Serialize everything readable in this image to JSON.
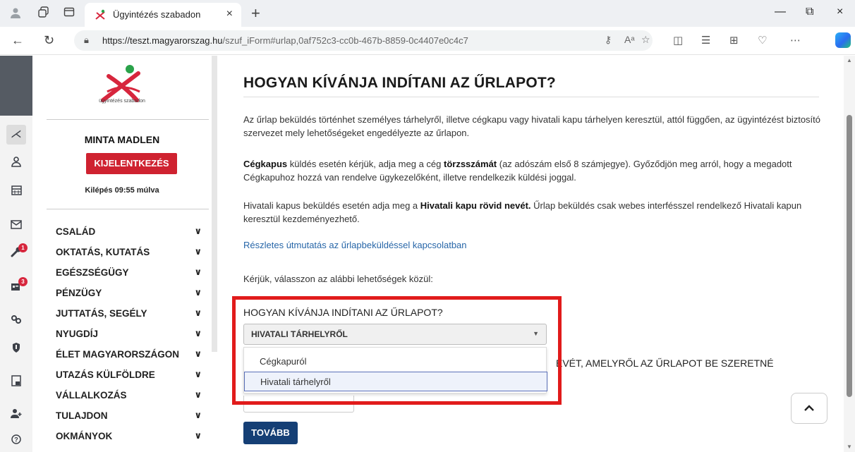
{
  "browser": {
    "tab_title": "Ügyintézés szabadon",
    "url_host": "https://teszt.magyarorszag.hu",
    "url_path": "/szuf_iForm#urlap,0af752c3-cc0b-467b-8859-0c4407e0c4c7",
    "new_tab_symbol": "+",
    "close_symbol": "×"
  },
  "rail": {
    "badge_wrench": "1",
    "badge_card": "3"
  },
  "sidebar": {
    "logo_text": "ügyintézés szabadon",
    "user_name": "MINTA MADLEN",
    "logout_label": "KIJELENTKEZÉS",
    "timer_text": "Kilépés 09:55 múlva",
    "menu": [
      {
        "label": "CSALÁD"
      },
      {
        "label": "OKTATÁS, KUTATÁS"
      },
      {
        "label": "EGÉSZSÉGÜGY"
      },
      {
        "label": "PÉNZÜGY"
      },
      {
        "label": "JUTTATÁS, SEGÉLY"
      },
      {
        "label": "NYUGDÍJ"
      },
      {
        "label": "ÉLET MAGYARORSZÁGON"
      },
      {
        "label": "UTAZÁS KÜLFÖLDRE"
      },
      {
        "label": "VÁLLALKOZÁS"
      },
      {
        "label": "TULAJDON"
      },
      {
        "label": "OKMÁNYOK"
      }
    ]
  },
  "main": {
    "heading": "HOGYAN KÍVÁNJA INDÍTANI AZ ŰRLAPOT?",
    "intro": "Az űrlap beküldés történhet személyes tárhelyről, illetve cégkapu vagy hivatali kapu tárhelyen keresztül, attól függően, az ügyintézést biztosító szervezet mely lehetőségeket engedélyezte az űrlapon.",
    "cegkapu_b1": "Cégkapus",
    "cegkapu_t1": " küldés esetén kérjük, adja meg a cég ",
    "cegkapu_b2": "törzsszámát",
    "cegkapu_t2": " (az adószám első 8 számjegye). Győződjön meg arról, hogy a megadott Cégkapuhoz hozzá van rendelve ügykezelőként, illetve rendelkezik küldési joggal.",
    "hivatali_t1": "Hivatali kapus beküldés esetén adja meg a ",
    "hivatali_b1": "Hivatali kapu rövid nevét.",
    "hivatali_t2": " Űrlap beküldés csak webes interfésszel rendelkező Hivatali kapun keresztül kezdeményezhető.",
    "guide_link": "Részletes útmutatás az űrlapbeküldéssel kapcsolatban",
    "choose_text": "Kérjük, válasszon az alábbi lehetőségek közül:",
    "question_label": "HOGYAN KÍVÁNJA INDÍTANI AZ ŰRLAPOT?",
    "select_value": "HIVATALI TÁRHELYRŐL",
    "options": [
      "Cégkapuról",
      "Hivatali tárhelyről"
    ],
    "behind_text": "EVÉT, AMELYRŐL AZ ŰRLAPOT BE SZERETNÉ",
    "next_label": "TOVÁBB"
  },
  "colors": {
    "logout_red": "#cf2230",
    "next_blue": "#153f75",
    "highlight_red": "#e11b1b",
    "link_blue": "#2766a8"
  }
}
